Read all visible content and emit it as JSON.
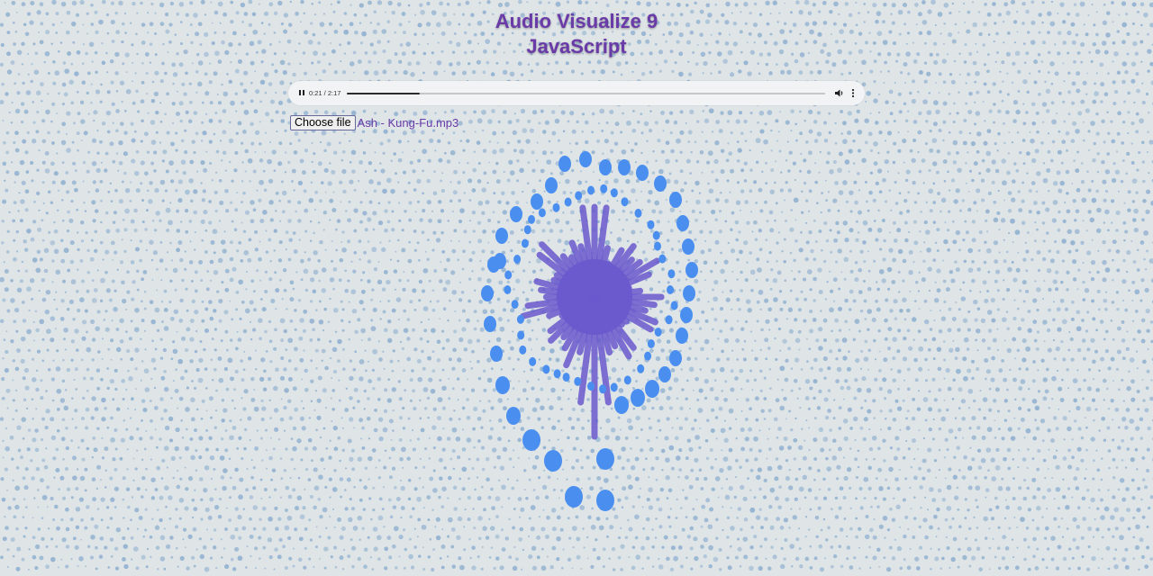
{
  "title": {
    "line1": "Audio Visualize 9",
    "line2": "JavaScript"
  },
  "player": {
    "time_display": "0:21 / 2:17",
    "elapsed_seconds": 21,
    "duration_seconds": 137,
    "state": "playing",
    "play_icon": "pause-icon",
    "volume_icon": "volume-icon",
    "more_icon": "more-vert-icon"
  },
  "file_input": {
    "button_label": "Choose file",
    "selected_file": "Ash - Kung-Fu.mp3"
  },
  "colors": {
    "background": "#dfe4e7",
    "background_dots": "#8fb0d0",
    "title": "#6a3aa8",
    "visualizer_rays": "#6a5acd",
    "visualizer_dots": "#4a8ff0"
  }
}
